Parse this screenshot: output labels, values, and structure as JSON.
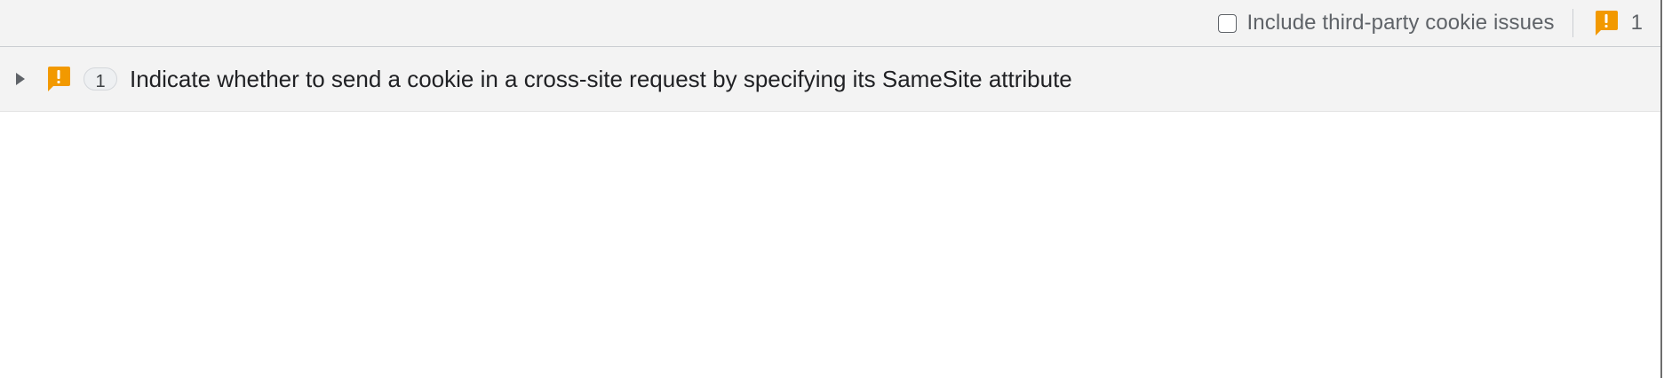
{
  "toolbar": {
    "third_party_checkbox_label": "Include third-party cookie issues",
    "third_party_checked": false,
    "issue_count": "1",
    "issue_icon": "warning-bubble-icon"
  },
  "issues": [
    {
      "expanded": false,
      "icon": "warning-bubble-icon",
      "count": "1",
      "title": "Indicate whether to send a cookie in a cross-site request by specifying its SameSite attribute"
    }
  ],
  "colors": {
    "warning": "#F29900",
    "toolbar_bg": "#F3F3F3",
    "text": "#202124",
    "secondary_text": "#5F6368"
  }
}
